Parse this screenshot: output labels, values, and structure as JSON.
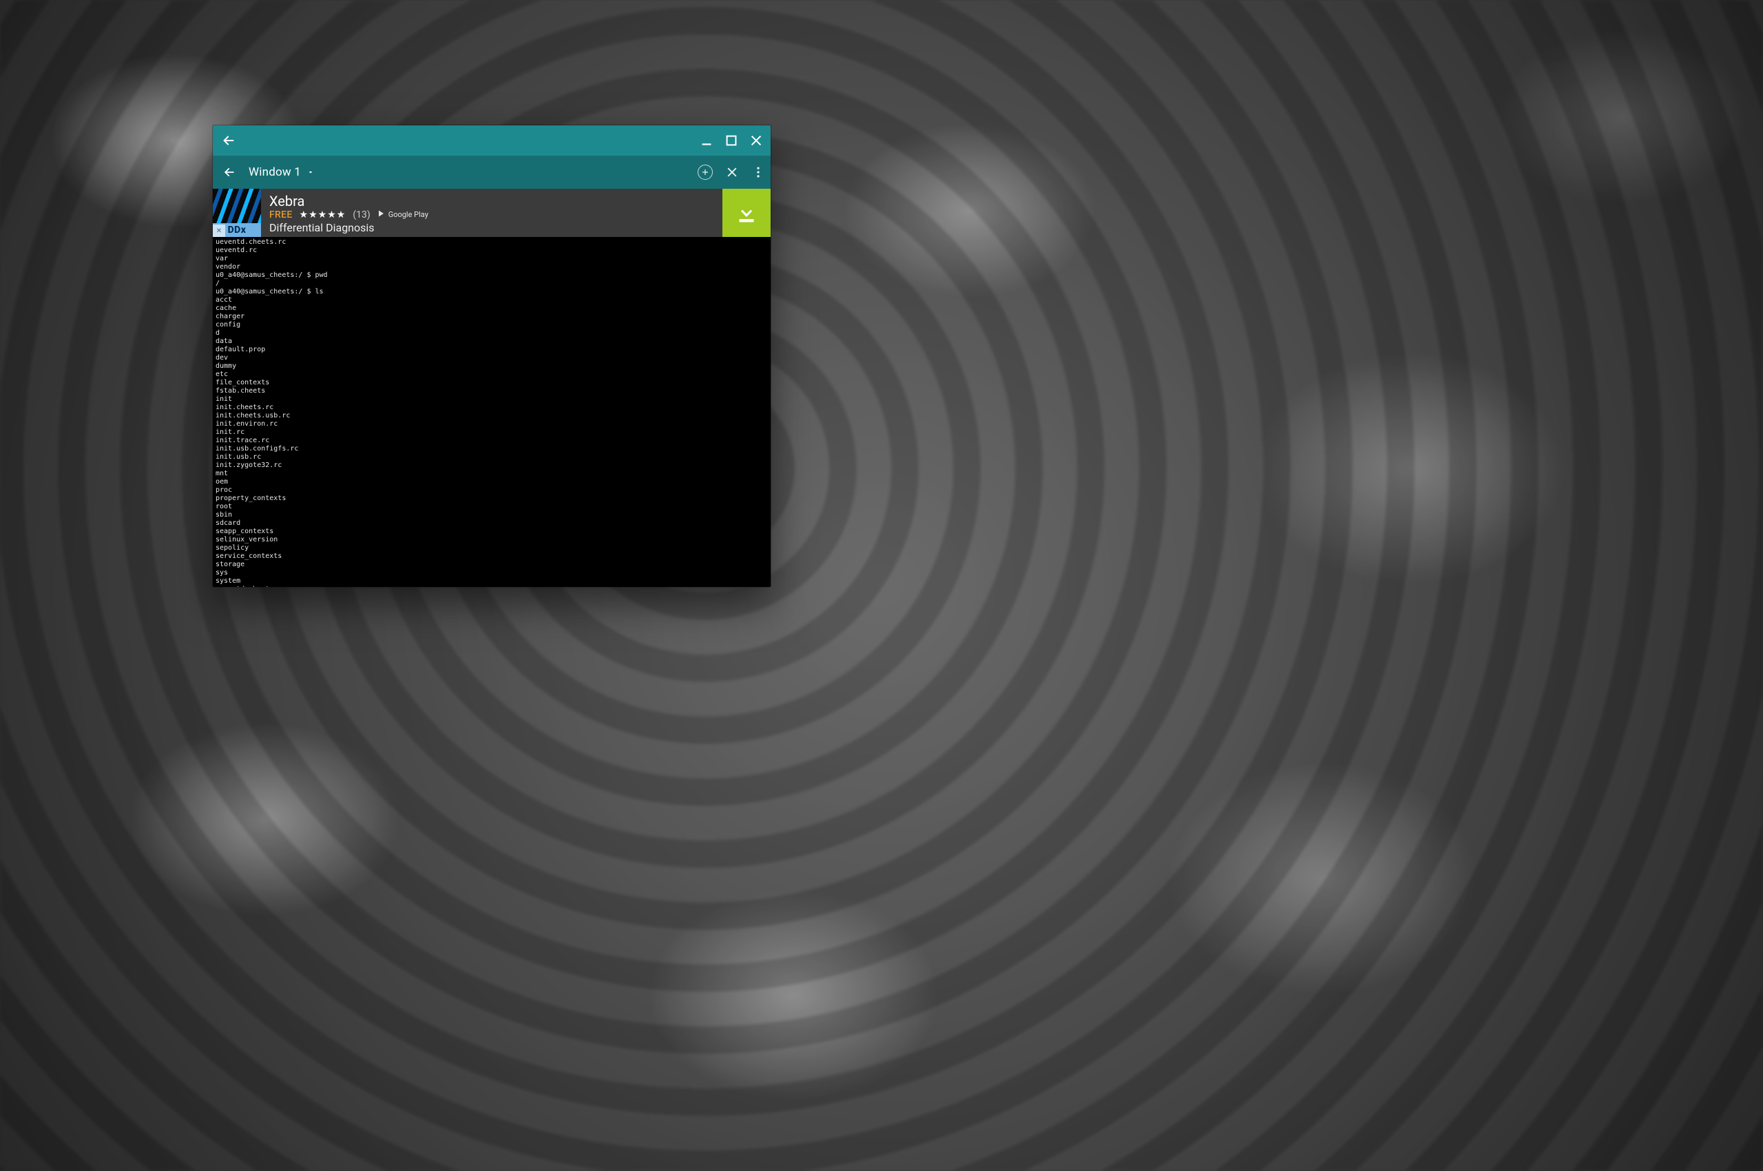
{
  "window": {
    "shell": {
      "back_label": "Back",
      "minimize_label": "Minimize",
      "maximize_label": "Maximize",
      "close_label": "Close"
    },
    "toolbar": {
      "title": "Window 1",
      "back_label": "Back",
      "new_tab_label": "New tab",
      "close_tab_label": "Close tab",
      "overflow_label": "More options"
    }
  },
  "ad": {
    "thumb_badge": "DDx",
    "ad_marker": "✕",
    "title": "Xebra",
    "price_label": "FREE",
    "rating_stars": "★★★★★",
    "rating_count": "(13)",
    "store_label": "Google Play",
    "subtitle": "Differential Diagnosis",
    "download_label": "Download"
  },
  "terminal": {
    "lines": [
      "ueventd.cheets.rc",
      "ueventd.rc",
      "var",
      "vendor",
      "u0_a40@samus_cheets:/ $ pwd",
      "/",
      "u0_a40@samus_cheets:/ $ ls",
      "acct",
      "cache",
      "charger",
      "config",
      "d",
      "data",
      "default.prop",
      "dev",
      "dummy",
      "etc",
      "file_contexts",
      "fstab.cheets",
      "init",
      "init.cheets.rc",
      "init.cheets.usb.rc",
      "init.environ.rc",
      "init.rc",
      "init.trace.rc",
      "init.usb.configfs.rc",
      "init.usb.rc",
      "init.zygote32.rc",
      "mnt",
      "oem",
      "proc",
      "property_contexts",
      "root",
      "sbin",
      "sdcard",
      "seapp_contexts",
      "selinux_version",
      "sepolicy",
      "service_contexts",
      "storage",
      "sys",
      "system",
      "ueventd.cheets.rc",
      "ueventd.rc",
      "var",
      "vendor"
    ],
    "prompt": "u0_a40@samus_cheets:/ $ "
  }
}
